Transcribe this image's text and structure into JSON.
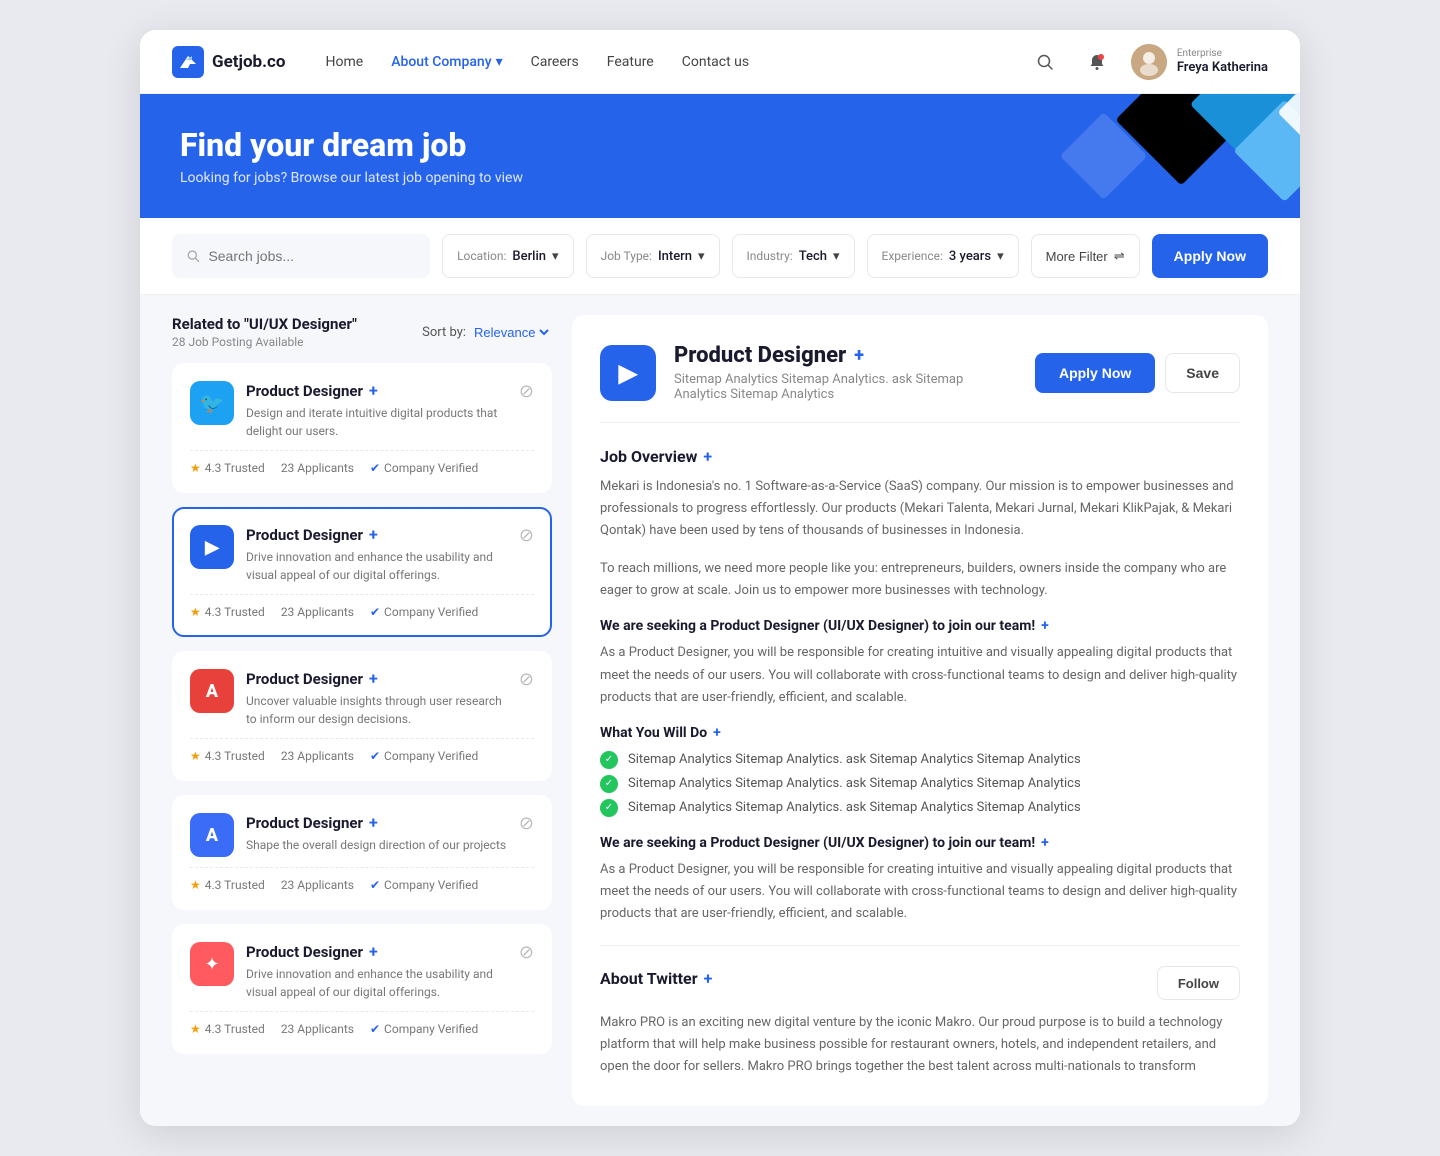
{
  "nav": {
    "logo_text": "Getjob.co",
    "links": [
      {
        "label": "Home",
        "active": false
      },
      {
        "label": "About Company",
        "active": true,
        "has_dropdown": true
      },
      {
        "label": "Careers",
        "active": false
      },
      {
        "label": "Feature",
        "active": false
      },
      {
        "label": "Contact us",
        "active": false
      }
    ],
    "user": {
      "label": "Enterprise",
      "name": "Freya Katherina"
    }
  },
  "hero": {
    "title": "Find your dream job",
    "subtitle": "Looking for jobs? Browse our latest job opening to view"
  },
  "search_bar": {
    "placeholder": "Search jobs...",
    "location_label": "Location:",
    "location_value": "Berlin",
    "jobtype_label": "Job Type:",
    "jobtype_value": "Intern",
    "industry_label": "Industry:",
    "industry_value": "Tech",
    "experience_label": "Experience:",
    "experience_value": "3 years",
    "more_filter": "More Filter",
    "apply_btn": "Apply Now"
  },
  "left_panel": {
    "related_label": "Related to",
    "related_query": "\"UI/UX Designer\"",
    "count": "28 Job Posting Available",
    "sort_label": "Sort by:",
    "sort_value": "Relevance",
    "cards": [
      {
        "id": 1,
        "logo_type": "twitter",
        "logo_icon": "🐦",
        "title": "Product Designer",
        "desc": "Design and iterate intuitive digital products that delight our users.",
        "rating": "4.3 Trusted",
        "applicants": "23 Applicants",
        "verified": "Company Verified",
        "selected": false
      },
      {
        "id": 2,
        "logo_type": "blue-arrow",
        "logo_icon": "▶",
        "title": "Product Designer",
        "desc": "Drive innovation and enhance the usability and visual appeal of our digital offerings.",
        "rating": "4.3 Trusted",
        "applicants": "23 Applicants",
        "verified": "Company Verified",
        "selected": true
      },
      {
        "id": 3,
        "logo_type": "adobe",
        "logo_icon": "A",
        "title": "Product Designer",
        "desc": "Uncover valuable insights through user research to inform our design decisions.",
        "rating": "4.3 Trusted",
        "applicants": "23 Applicants",
        "verified": "Company Verified",
        "selected": false
      },
      {
        "id": 4,
        "logo_type": "blue-a",
        "logo_icon": "A",
        "title": "Product Designer",
        "desc": "Shape the overall design direction of our projects",
        "rating": "4.3 Trusted",
        "applicants": "23 Applicants",
        "verified": "Company Verified",
        "selected": false
      },
      {
        "id": 5,
        "logo_type": "airbnb",
        "logo_icon": "✦",
        "title": "Product Designer",
        "desc": "Drive innovation and enhance the usability and visual appeal of our digital offerings.",
        "rating": "4.3 Trusted",
        "applicants": "23 Applicants",
        "verified": "Company Verified",
        "selected": false
      }
    ]
  },
  "right_panel": {
    "company_icon": "▶",
    "job_title": "Product Designer",
    "job_subtitle": "Sitemap Analytics Sitemap Analytics. ask Sitemap Analytics Sitemap Analytics",
    "apply_btn": "Apply Now",
    "save_btn": "Save",
    "overview_title": "Job Overview",
    "overview_p1": "Mekari is Indonesia's no. 1 Software-as-a-Service (SaaS) company. Our mission is to empower businesses and professionals to progress effortlessly. Our products (Mekari Talenta, Mekari Jurnal, Mekari KlikPajak, & Mekari Qontak) have been used by tens of thousands of businesses in Indonesia.",
    "overview_p2": "To reach millions, we need more people like you: entrepreneurs, builders, owners inside the company who are eager to grow at scale. Join us to empower more businesses with technology.",
    "seeking_title": "We are seeking a Product Designer (UI/UX Designer) to join our team!",
    "seeking_desc": "As a Product Designer, you will be responsible for creating intuitive and visually appealing digital products that meet the needs of our users. You will collaborate with cross-functional teams to design and deliver high-quality products that are user-friendly, efficient, and scalable.",
    "what_you_do_title": "What You Will Do",
    "what_you_do_items": [
      "Sitemap Analytics Sitemap Analytics. ask Sitemap Analytics Sitemap Analytics",
      "Sitemap Analytics Sitemap Analytics. ask Sitemap Analytics Sitemap Analytics",
      "Sitemap Analytics Sitemap Analytics. ask Sitemap Analytics Sitemap Analytics"
    ],
    "seeking2_title": "We are seeking a Product Designer (UI/UX Designer) to join our team!",
    "seeking2_desc": "As a Product Designer, you will be responsible for creating intuitive and visually appealing digital products that meet the needs of our users. You will collaborate with cross-functional teams to design and deliver high-quality products that are user-friendly, efficient, and scalable.",
    "about_title": "About Twitter",
    "follow_btn": "Follow",
    "about_text": "Makro PRO is an exciting new digital venture by the iconic Makro. Our proud purpose is to build a technology platform that will help make business possible for restaurant owners, hotels, and independent retailers, and open the door for sellers. Makro PRO brings together the best talent across multi-nationals to transform"
  }
}
